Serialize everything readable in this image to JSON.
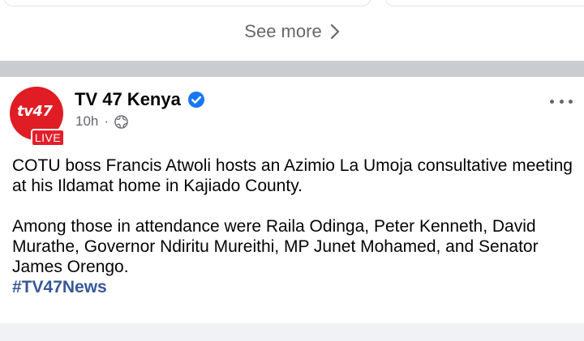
{
  "see_more": {
    "label": "See more",
    "icon": "chevron-right-icon"
  },
  "post": {
    "page_name": "TV 47 Kenya",
    "verified_icon": "verified-badge-icon",
    "avatar": {
      "logo_text": "tv47",
      "badge": "LIVE"
    },
    "time": "10h",
    "separator": "·",
    "privacy_icon": "globe-icon",
    "more_icon": "more-options-icon",
    "text_paragraph_1": "COTU boss Francis Atwoli hosts an Azimio La Umoja consultative meeting at his Ildamat home in Kajiado County.",
    "text_paragraph_2": "Among those in attendance were Raila Odinga, Peter Kenneth, David Murathe, Governor Ndiritu Mureithi, MP Junet Mohamed, and Senator James Orengo.",
    "hashtag": "#TV47News"
  },
  "colors": {
    "brand_red": "#e01d24",
    "verified_blue": "#1877f2",
    "hashtag_blue": "#385898",
    "divider_gray": "#c9ccd1",
    "secondary_text": "#65676b"
  }
}
